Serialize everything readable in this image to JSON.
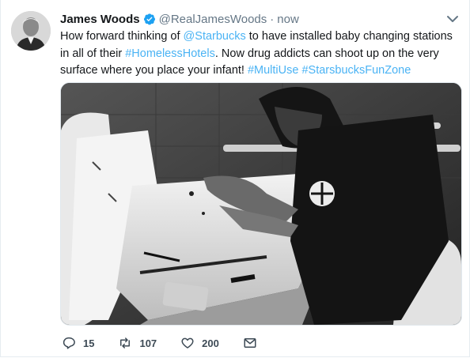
{
  "tweet": {
    "author_name": "James Woods",
    "handle": "@RealJamesWoods",
    "separator": "·",
    "time": "now",
    "text_parts": [
      {
        "t": "How forward thinking of ",
        "link": false
      },
      {
        "t": "@Starbucks",
        "link": true
      },
      {
        "t": " to have installed baby changing stations in all of their ",
        "link": false
      },
      {
        "t": "#HomelessHotels",
        "link": true
      },
      {
        "t": ". Now drug addicts can shoot up on the very surface where you place your infant! ",
        "link": false
      },
      {
        "t": "#MultiUse",
        "link": true
      },
      {
        "t": "  ",
        "link": false
      },
      {
        "t": "#StarsbucksFunZone",
        "link": true
      }
    ]
  },
  "actions": {
    "reply_count": "15",
    "retweet_count": "107",
    "like_count": "200"
  },
  "icons": {
    "verified": "verified-badge-icon",
    "caret": "chevron-down-icon",
    "reply": "reply-icon",
    "retweet": "retweet-icon",
    "like": "heart-icon",
    "dm": "envelope-icon"
  },
  "colors": {
    "link": "#4ab3f4",
    "verified": "#1da1f2",
    "muted": "#657786"
  }
}
